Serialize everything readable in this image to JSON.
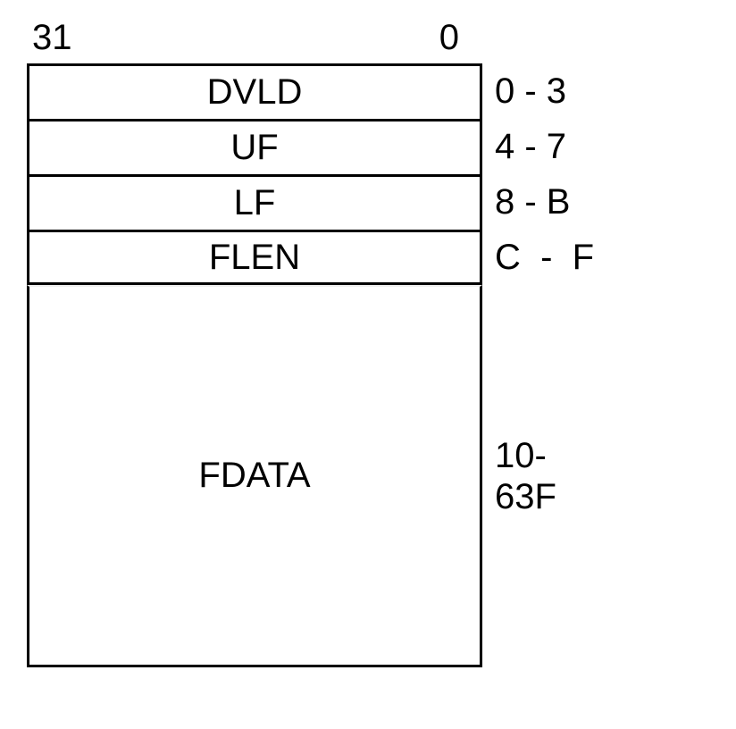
{
  "bits": {
    "msb": "31",
    "lsb": "0"
  },
  "rows": [
    {
      "name": "DVLD",
      "addr": "0 - 3"
    },
    {
      "name": "UF",
      "addr": "4 - 7"
    },
    {
      "name": "LF",
      "addr": "8 - B"
    },
    {
      "name": "FLEN",
      "addr": "C  -  F"
    }
  ],
  "data_block": {
    "name": "FDATA",
    "addr_line1": "10-",
    "addr_line2": "63F"
  }
}
